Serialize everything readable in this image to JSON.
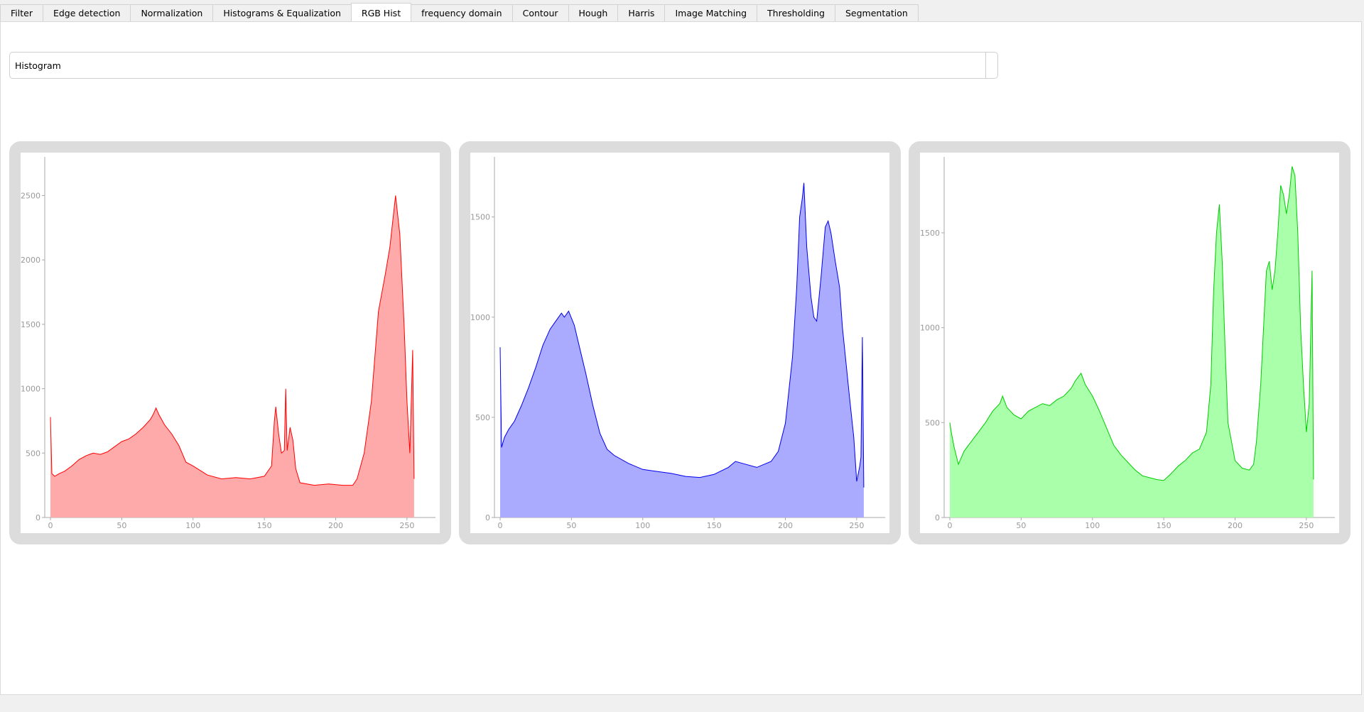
{
  "tabs": [
    {
      "label": "Filter",
      "active": false
    },
    {
      "label": "Edge detection",
      "active": false
    },
    {
      "label": "Normalization",
      "active": false
    },
    {
      "label": "Histograms & Equalization",
      "active": false
    },
    {
      "label": "RGB Hist",
      "active": true
    },
    {
      "label": "frequency domain",
      "active": false
    },
    {
      "label": "Contour",
      "active": false
    },
    {
      "label": "Hough",
      "active": false
    },
    {
      "label": "Harris",
      "active": false
    },
    {
      "label": "Image Matching",
      "active": false
    },
    {
      "label": "Thresholding",
      "active": false
    },
    {
      "label": "Segmentation",
      "active": false
    }
  ],
  "mode_select": {
    "value": "Histogram"
  },
  "chart_data": [
    {
      "type": "area",
      "series_color": "#ff0000",
      "fill_color": "#ffaaaa",
      "xlim": [
        -4,
        270
      ],
      "ylim": [
        0,
        2800
      ],
      "x_ticks": [
        0,
        50,
        100,
        150,
        200,
        250
      ],
      "y_ticks": [
        0,
        500,
        1000,
        1500,
        2000,
        2500
      ],
      "points": [
        [
          0,
          780
        ],
        [
          1,
          340
        ],
        [
          3,
          320
        ],
        [
          6,
          340
        ],
        [
          10,
          360
        ],
        [
          15,
          400
        ],
        [
          20,
          450
        ],
        [
          25,
          480
        ],
        [
          30,
          500
        ],
        [
          35,
          490
        ],
        [
          40,
          510
        ],
        [
          45,
          550
        ],
        [
          50,
          590
        ],
        [
          55,
          610
        ],
        [
          60,
          650
        ],
        [
          65,
          700
        ],
        [
          70,
          760
        ],
        [
          72,
          800
        ],
        [
          74,
          850
        ],
        [
          76,
          800
        ],
        [
          80,
          720
        ],
        [
          85,
          650
        ],
        [
          90,
          560
        ],
        [
          95,
          430
        ],
        [
          100,
          400
        ],
        [
          110,
          330
        ],
        [
          120,
          300
        ],
        [
          130,
          310
        ],
        [
          140,
          300
        ],
        [
          150,
          320
        ],
        [
          155,
          400
        ],
        [
          157,
          750
        ],
        [
          158,
          860
        ],
        [
          160,
          650
        ],
        [
          162,
          500
        ],
        [
          164,
          520
        ],
        [
          165,
          1000
        ],
        [
          166,
          520
        ],
        [
          168,
          700
        ],
        [
          170,
          600
        ],
        [
          172,
          380
        ],
        [
          175,
          270
        ],
        [
          185,
          250
        ],
        [
          195,
          260
        ],
        [
          205,
          250
        ],
        [
          212,
          250
        ],
        [
          215,
          300
        ],
        [
          220,
          500
        ],
        [
          225,
          900
        ],
        [
          230,
          1600
        ],
        [
          235,
          1900
        ],
        [
          238,
          2100
        ],
        [
          240,
          2300
        ],
        [
          242,
          2500
        ],
        [
          245,
          2200
        ],
        [
          248,
          1500
        ],
        [
          250,
          900
        ],
        [
          252,
          500
        ],
        [
          254,
          1300
        ],
        [
          255,
          300
        ]
      ]
    },
    {
      "type": "area",
      "series_color": "#0000ee",
      "fill_color": "#aaaaff",
      "xlim": [
        -4,
        270
      ],
      "ylim": [
        0,
        1800
      ],
      "x_ticks": [
        0,
        50,
        100,
        150,
        200,
        250
      ],
      "y_ticks": [
        0,
        500,
        1000,
        1500
      ],
      "points": [
        [
          0,
          850
        ],
        [
          1,
          350
        ],
        [
          3,
          400
        ],
        [
          6,
          440
        ],
        [
          10,
          480
        ],
        [
          15,
          560
        ],
        [
          20,
          650
        ],
        [
          25,
          750
        ],
        [
          30,
          860
        ],
        [
          35,
          940
        ],
        [
          40,
          990
        ],
        [
          43,
          1020
        ],
        [
          45,
          1000
        ],
        [
          48,
          1030
        ],
        [
          52,
          960
        ],
        [
          55,
          870
        ],
        [
          60,
          720
        ],
        [
          65,
          560
        ],
        [
          70,
          420
        ],
        [
          75,
          340
        ],
        [
          80,
          310
        ],
        [
          90,
          270
        ],
        [
          100,
          240
        ],
        [
          110,
          230
        ],
        [
          120,
          220
        ],
        [
          130,
          205
        ],
        [
          140,
          200
        ],
        [
          150,
          215
        ],
        [
          160,
          250
        ],
        [
          165,
          280
        ],
        [
          170,
          270
        ],
        [
          180,
          250
        ],
        [
          190,
          280
        ],
        [
          195,
          330
        ],
        [
          200,
          470
        ],
        [
          205,
          800
        ],
        [
          208,
          1150
        ],
        [
          210,
          1500
        ],
        [
          212,
          1600
        ],
        [
          213,
          1670
        ],
        [
          215,
          1350
        ],
        [
          218,
          1100
        ],
        [
          220,
          1000
        ],
        [
          222,
          980
        ],
        [
          225,
          1200
        ],
        [
          228,
          1450
        ],
        [
          230,
          1480
        ],
        [
          232,
          1420
        ],
        [
          235,
          1280
        ],
        [
          238,
          1150
        ],
        [
          240,
          950
        ],
        [
          245,
          600
        ],
        [
          248,
          400
        ],
        [
          250,
          180
        ],
        [
          252,
          250
        ],
        [
          253,
          300
        ],
        [
          254,
          900
        ],
        [
          255,
          150
        ]
      ]
    },
    {
      "type": "area",
      "series_color": "#00cc00",
      "fill_color": "#aaffaa",
      "xlim": [
        -4,
        270
      ],
      "ylim": [
        0,
        1900
      ],
      "x_ticks": [
        0,
        50,
        100,
        150,
        200,
        250
      ],
      "y_ticks": [
        0,
        500,
        1000,
        1500
      ],
      "points": [
        [
          0,
          500
        ],
        [
          1,
          450
        ],
        [
          3,
          370
        ],
        [
          6,
          280
        ],
        [
          10,
          350
        ],
        [
          15,
          400
        ],
        [
          20,
          450
        ],
        [
          25,
          500
        ],
        [
          30,
          560
        ],
        [
          35,
          600
        ],
        [
          37,
          640
        ],
        [
          40,
          580
        ],
        [
          45,
          540
        ],
        [
          50,
          520
        ],
        [
          55,
          560
        ],
        [
          60,
          580
        ],
        [
          65,
          600
        ],
        [
          70,
          590
        ],
        [
          75,
          620
        ],
        [
          80,
          640
        ],
        [
          85,
          680
        ],
        [
          88,
          720
        ],
        [
          90,
          740
        ],
        [
          92,
          760
        ],
        [
          95,
          700
        ],
        [
          100,
          640
        ],
        [
          105,
          560
        ],
        [
          110,
          470
        ],
        [
          115,
          380
        ],
        [
          120,
          330
        ],
        [
          125,
          290
        ],
        [
          130,
          250
        ],
        [
          135,
          220
        ],
        [
          140,
          210
        ],
        [
          145,
          200
        ],
        [
          150,
          195
        ],
        [
          155,
          230
        ],
        [
          160,
          270
        ],
        [
          165,
          300
        ],
        [
          170,
          340
        ],
        [
          175,
          360
        ],
        [
          180,
          450
        ],
        [
          183,
          700
        ],
        [
          185,
          1200
        ],
        [
          187,
          1500
        ],
        [
          189,
          1650
        ],
        [
          191,
          1350
        ],
        [
          193,
          900
        ],
        [
          195,
          500
        ],
        [
          200,
          300
        ],
        [
          205,
          260
        ],
        [
          210,
          250
        ],
        [
          213,
          280
        ],
        [
          215,
          400
        ],
        [
          218,
          700
        ],
        [
          220,
          1000
        ],
        [
          222,
          1300
        ],
        [
          224,
          1350
        ],
        [
          226,
          1200
        ],
        [
          228,
          1300
        ],
        [
          230,
          1500
        ],
        [
          232,
          1750
        ],
        [
          234,
          1700
        ],
        [
          236,
          1600
        ],
        [
          238,
          1700
        ],
        [
          240,
          1850
        ],
        [
          242,
          1800
        ],
        [
          244,
          1500
        ],
        [
          246,
          1000
        ],
        [
          248,
          700
        ],
        [
          250,
          450
        ],
        [
          252,
          600
        ],
        [
          254,
          1300
        ],
        [
          255,
          200
        ]
      ]
    }
  ]
}
